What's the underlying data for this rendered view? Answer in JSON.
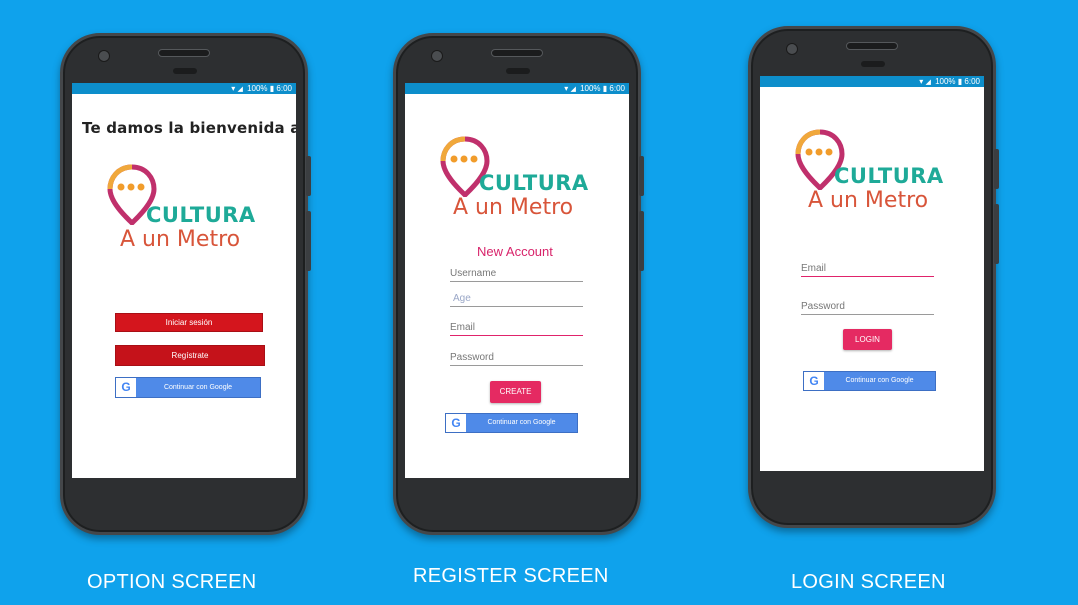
{
  "status_bar": {
    "battery": "100%",
    "time": "6:00"
  },
  "option_screen": {
    "welcome": "Te damos la bienvenida a",
    "logo": {
      "line1": "CULTURA",
      "line2": "A un Metro"
    },
    "login_button": "Iniciar sesión",
    "register_button": "Regístrate",
    "google_button": "Continuar con Google",
    "caption": "OPTION SCREEN"
  },
  "register_screen": {
    "logo": {
      "line1": "CULTURA",
      "line2": "A un Metro"
    },
    "title": "New Account",
    "fields": {
      "username": "Username",
      "age": "Age",
      "email": "Email",
      "password": "Password"
    },
    "create_button": "CREATE",
    "google_button": "Continuar con Google",
    "caption": "REGISTER SCREEN"
  },
  "login_screen": {
    "logo": {
      "line1": "CULTURA",
      "line2": "A un Metro"
    },
    "fields": {
      "email": "Email",
      "password": "Password"
    },
    "login_button": "LOGIN",
    "google_button": "Continuar con Google",
    "caption": "LOGIN SCREEN"
  },
  "colors": {
    "background": "#0fa2ec",
    "brand_teal": "#1eaa98",
    "brand_red": "#d8553a",
    "accent_pink": "#e52a62",
    "button_red": "#d4151d",
    "google_blue": "#4f8ae8"
  }
}
